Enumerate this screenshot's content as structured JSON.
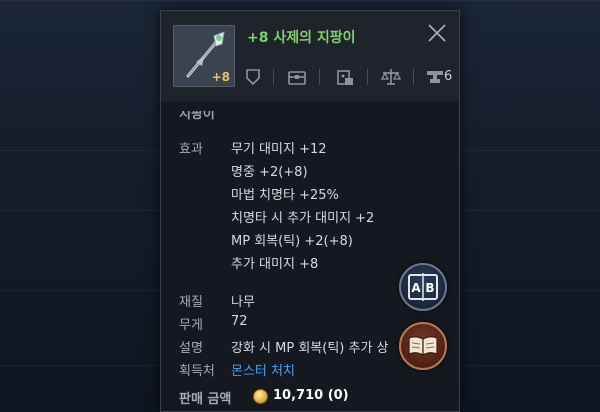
{
  "item": {
    "name": "+8 사제의 지팡이",
    "enhance": "+8",
    "section_title": "지팡이",
    "icons": [
      {
        "name": "shield-icon"
      },
      {
        "name": "chest-icon"
      },
      {
        "name": "storage-icon"
      },
      {
        "name": "scale-icon"
      },
      {
        "name": "anvil-icon",
        "count": "6"
      }
    ]
  },
  "effects": {
    "label": "효과",
    "lines": [
      "무기 대미지 +12",
      "명중 +2(+8)",
      "마법 치명타 +25%",
      "치명타 시 추가 대미지 +2",
      "MP 회복(틱) +2(+8)",
      "추가 대미지 +8"
    ]
  },
  "info": {
    "material_label": "재질",
    "material_value": "나무",
    "weight_label": "무게",
    "weight_value": "72",
    "desc_label": "설명",
    "desc_value": "강화 시 MP 회복(틱) 추가 상",
    "source_label": "획득처",
    "source_value": "몬스터 처치"
  },
  "price": {
    "label": "판매 금액",
    "value": "10,710 (0)"
  },
  "fab": {
    "compare_label": "A|B"
  },
  "colors": {
    "item_name": "#7ed26a",
    "enhance": "#f0c060",
    "link": "#3fa3ff",
    "panel_bg": "#15191f"
  }
}
